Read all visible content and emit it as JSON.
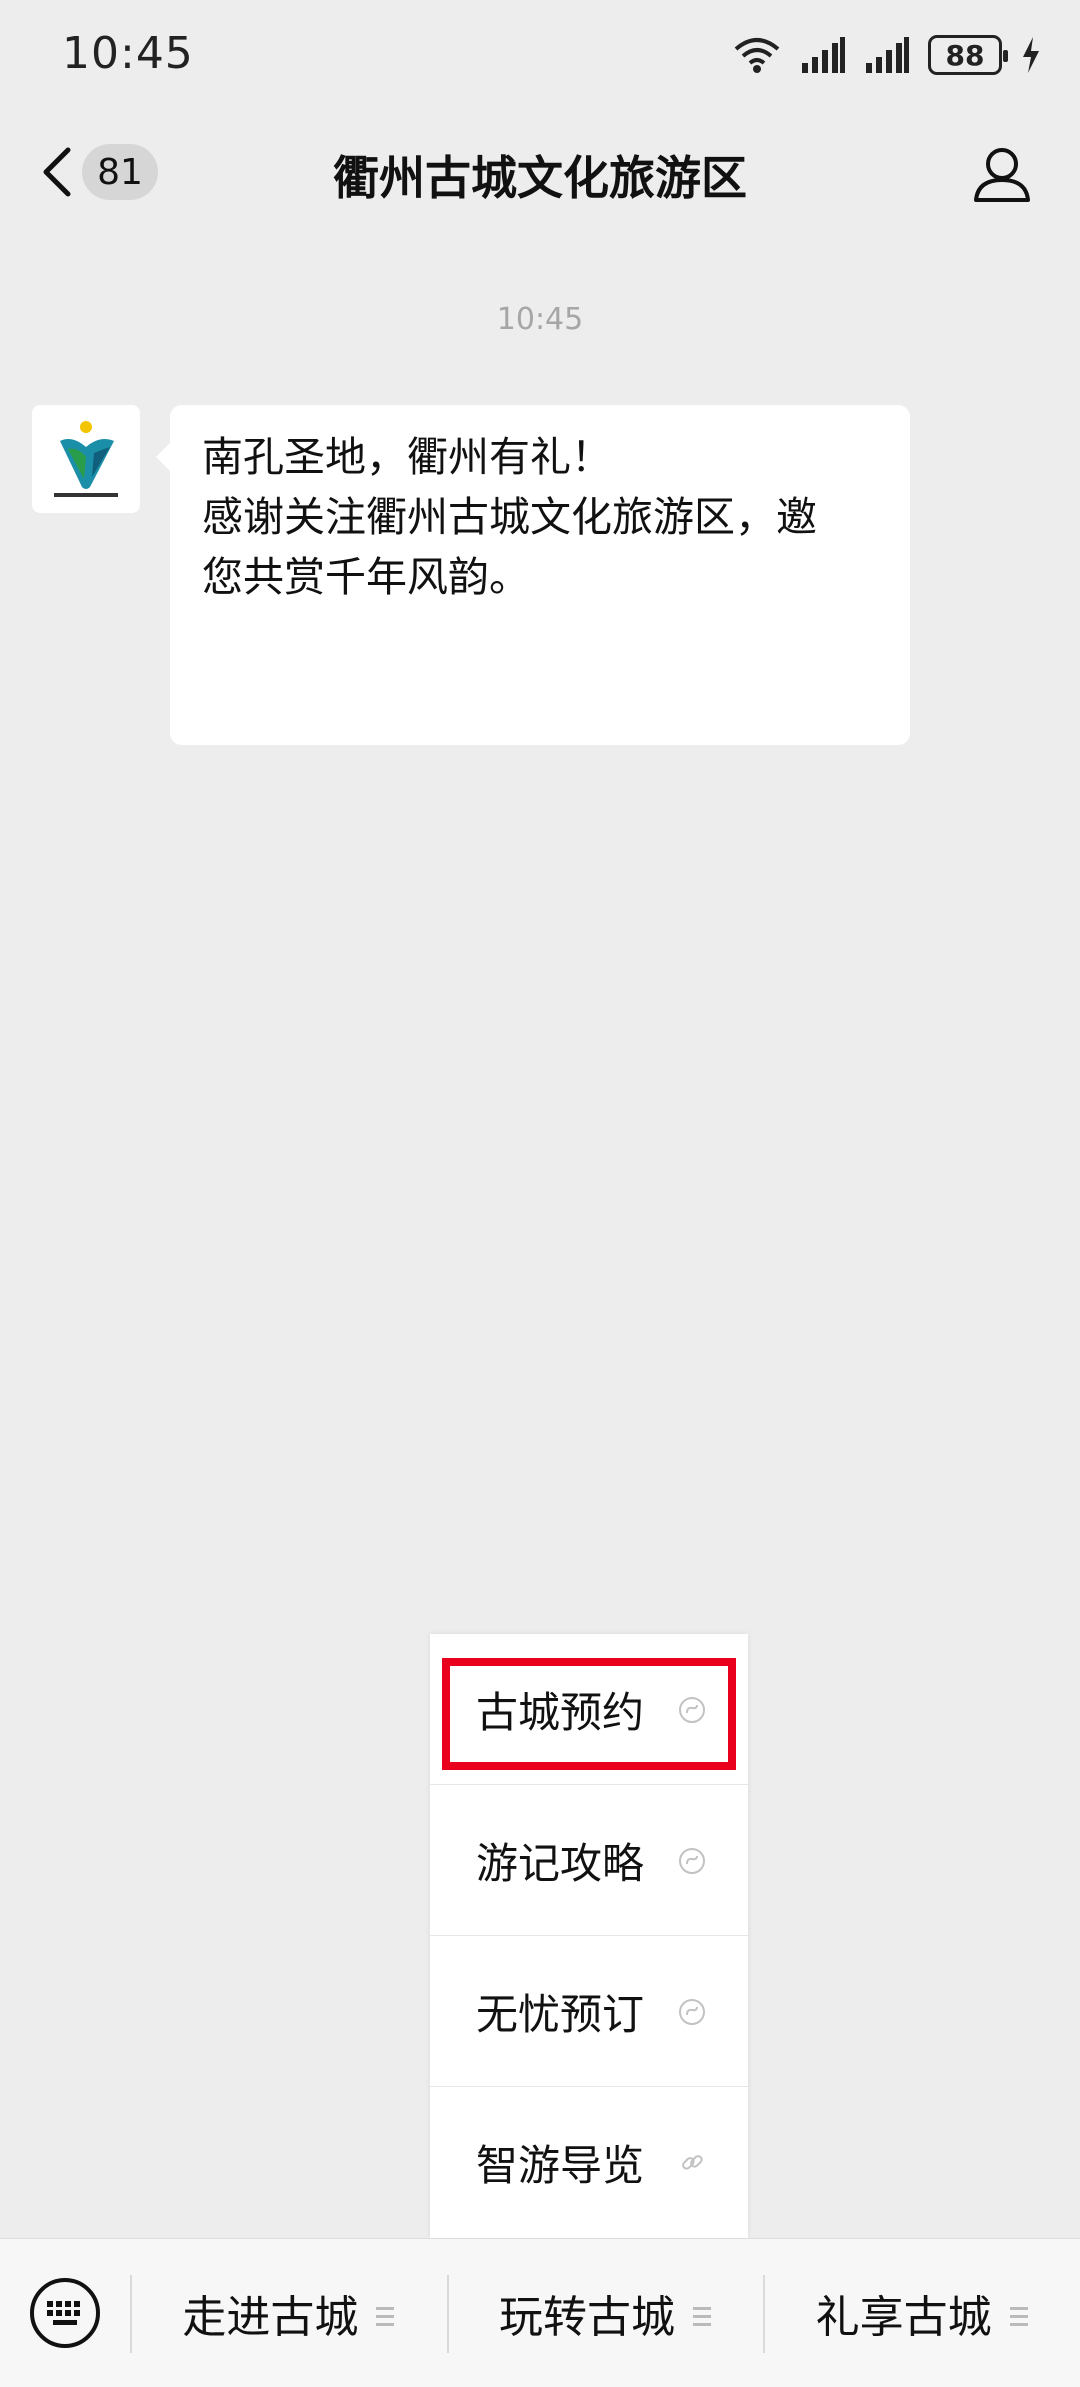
{
  "status_bar": {
    "time": "10:45",
    "battery": "88"
  },
  "nav": {
    "unread_count": "81",
    "title": "衢州古城文化旅游区"
  },
  "chat": {
    "timestamp": "10:45",
    "avatar_caption": "衢州古城文化旅游区",
    "message_lines": [
      "南孔圣地，衢州有礼！",
      "感谢关注衢州古城文化旅游区，邀",
      "您共赏千年风韵。"
    ]
  },
  "submenu": {
    "items": [
      {
        "label": "古城预约"
      },
      {
        "label": "游记攻略"
      },
      {
        "label": "无忧预订"
      },
      {
        "label": "智游导览"
      }
    ]
  },
  "bottom_menu": {
    "tabs": [
      {
        "label": "走进古城"
      },
      {
        "label": "玩转古城"
      },
      {
        "label": "礼享古城"
      }
    ]
  },
  "colors": {
    "highlight": "#e8001c",
    "background": "#ededed"
  }
}
